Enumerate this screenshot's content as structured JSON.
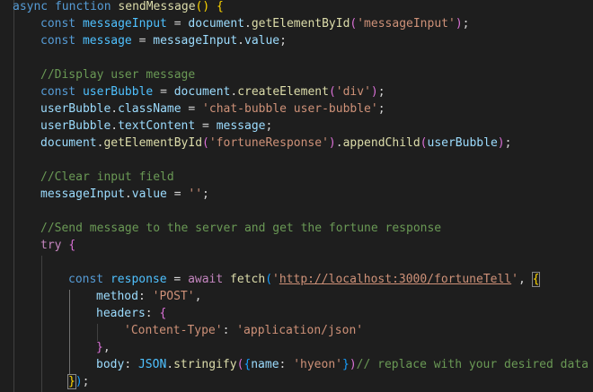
{
  "editor": {
    "language": "javascript",
    "colors": {
      "background": "#1e1e1e",
      "keyword": "#569cd6",
      "control": "#c586c0",
      "function": "#dcdcaa",
      "variable": "#9cdcfe",
      "string": "#ce9178",
      "comment": "#6a9955"
    },
    "lines": [
      [
        [
          "k",
          "async"
        ],
        [
          "t",
          " "
        ],
        [
          "k",
          "function"
        ],
        [
          "t",
          " "
        ],
        [
          "f",
          "sendMessage"
        ],
        [
          "b1",
          "()"
        ],
        [
          "t",
          " "
        ],
        [
          "b1",
          "{"
        ]
      ],
      [
        [
          "k",
          "const"
        ],
        [
          "t",
          " "
        ],
        [
          "p",
          "messageInput"
        ],
        [
          "t",
          " = "
        ],
        [
          "v",
          "document"
        ],
        [
          "t",
          "."
        ],
        [
          "f",
          "getElementById"
        ],
        [
          "b2",
          "("
        ],
        [
          "s",
          "'messageInput'"
        ],
        [
          "b2",
          ")"
        ],
        [
          "t",
          ";"
        ]
      ],
      [
        [
          "k",
          "const"
        ],
        [
          "t",
          " "
        ],
        [
          "p",
          "message"
        ],
        [
          "t",
          " = "
        ],
        [
          "v",
          "messageInput"
        ],
        [
          "t",
          "."
        ],
        [
          "v",
          "value"
        ],
        [
          "t",
          ";"
        ]
      ],
      [],
      [
        [
          "c",
          "//Display user message"
        ]
      ],
      [
        [
          "k",
          "const"
        ],
        [
          "t",
          " "
        ],
        [
          "p",
          "userBubble"
        ],
        [
          "t",
          " = "
        ],
        [
          "v",
          "document"
        ],
        [
          "t",
          "."
        ],
        [
          "f",
          "createElement"
        ],
        [
          "b2",
          "("
        ],
        [
          "s",
          "'div'"
        ],
        [
          "b2",
          ")"
        ],
        [
          "t",
          ";"
        ]
      ],
      [
        [
          "v",
          "userBubble"
        ],
        [
          "t",
          "."
        ],
        [
          "v",
          "className"
        ],
        [
          "t",
          " = "
        ],
        [
          "s",
          "'chat-bubble user-bubble'"
        ],
        [
          "t",
          ";"
        ]
      ],
      [
        [
          "v",
          "userBubble"
        ],
        [
          "t",
          "."
        ],
        [
          "v",
          "textContent"
        ],
        [
          "t",
          " = "
        ],
        [
          "v",
          "message"
        ],
        [
          "t",
          ";"
        ]
      ],
      [
        [
          "v",
          "document"
        ],
        [
          "t",
          "."
        ],
        [
          "f",
          "getElementById"
        ],
        [
          "b2",
          "("
        ],
        [
          "s",
          "'fortuneResponse'"
        ],
        [
          "b2",
          ")"
        ],
        [
          "t",
          "."
        ],
        [
          "f",
          "appendChild"
        ],
        [
          "b2",
          "("
        ],
        [
          "v",
          "userBubble"
        ],
        [
          "b2",
          ")"
        ],
        [
          "t",
          ";"
        ]
      ],
      [],
      [
        [
          "c",
          "//Clear input field"
        ]
      ],
      [
        [
          "v",
          "messageInput"
        ],
        [
          "t",
          "."
        ],
        [
          "v",
          "value"
        ],
        [
          "t",
          " = "
        ],
        [
          "s",
          "''"
        ],
        [
          "t",
          ";"
        ]
      ],
      [],
      [
        [
          "c",
          "//Send message to the server and get the fortune response"
        ]
      ],
      [
        [
          "kc",
          "try"
        ],
        [
          "t",
          " "
        ],
        [
          "b2",
          "{"
        ]
      ],
      [],
      [
        [
          "k",
          "const"
        ],
        [
          "t",
          " "
        ],
        [
          "p",
          "response"
        ],
        [
          "t",
          " = "
        ],
        [
          "kc",
          "await"
        ],
        [
          "t",
          " "
        ],
        [
          "f",
          "fetch"
        ],
        [
          "b3",
          "("
        ],
        [
          "s",
          "'"
        ],
        [
          "s u",
          "http://localhost:3000/fortuneTell"
        ],
        [
          "s",
          "'"
        ],
        [
          "t",
          ", "
        ],
        [
          "b1 hl",
          "{"
        ]
      ],
      [
        [
          "v",
          "method"
        ],
        [
          "t",
          ": "
        ],
        [
          "s",
          "'POST'"
        ],
        [
          "t",
          ","
        ]
      ],
      [
        [
          "v",
          "headers"
        ],
        [
          "t",
          ": "
        ],
        [
          "b2",
          "{"
        ]
      ],
      [
        [
          "s",
          "'Content-Type'"
        ],
        [
          "t",
          ": "
        ],
        [
          "s",
          "'application/json'"
        ]
      ],
      [
        [
          "b2",
          "}"
        ],
        [
          "t",
          ","
        ]
      ],
      [
        [
          "v",
          "body"
        ],
        [
          "t",
          ": "
        ],
        [
          "p",
          "JSON"
        ],
        [
          "t",
          "."
        ],
        [
          "f",
          "stringify"
        ],
        [
          "b2",
          "("
        ],
        [
          "b3",
          "{"
        ],
        [
          "v",
          "name"
        ],
        [
          "t",
          ": "
        ],
        [
          "s",
          "'hyeon'"
        ],
        [
          "b3",
          "}"
        ],
        [
          "b2",
          ")"
        ],
        [
          "c",
          "// replace with your desired data"
        ]
      ],
      [
        [
          "b1 hl",
          "}"
        ],
        [
          "b3",
          ")"
        ],
        [
          "t",
          ";"
        ]
      ]
    ],
    "indents": [
      0,
      1,
      1,
      0,
      1,
      1,
      1,
      1,
      1,
      0,
      1,
      1,
      0,
      1,
      1,
      0,
      2,
      3,
      3,
      4,
      3,
      3,
      2
    ]
  }
}
